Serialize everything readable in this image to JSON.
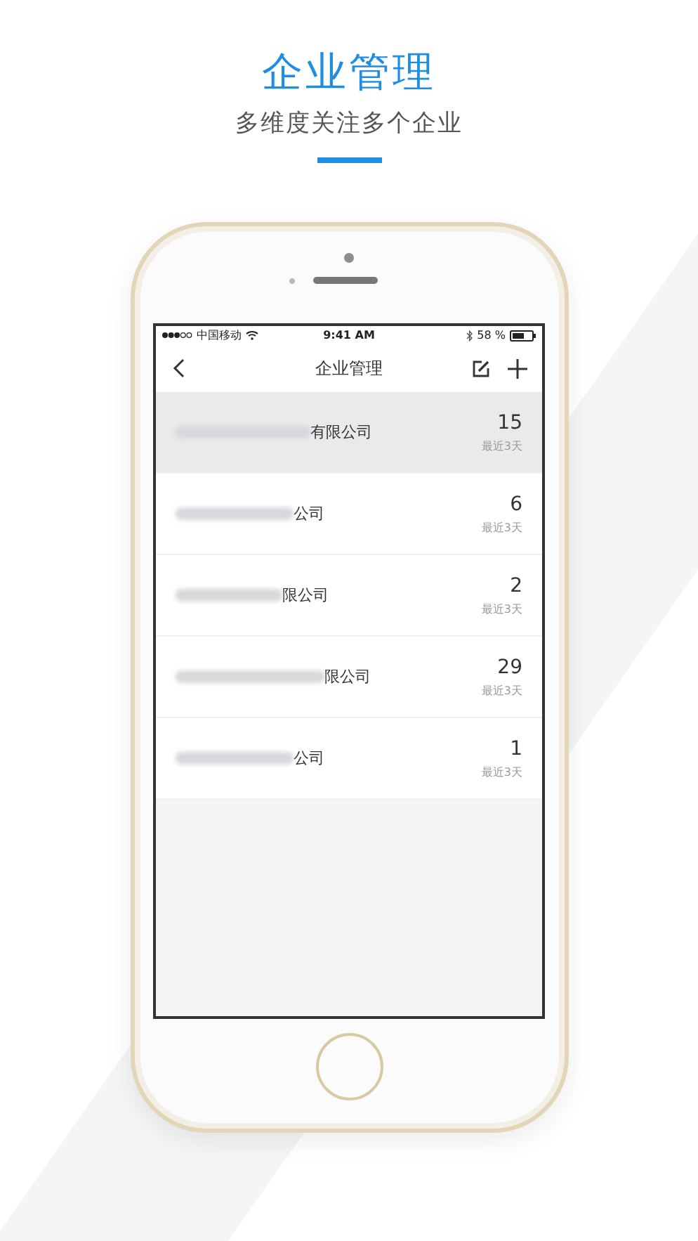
{
  "header": {
    "title": "企业管理",
    "subtitle": "多维度关注多个企业"
  },
  "status_bar": {
    "carrier": "中国移动",
    "time": "9:41 AM",
    "battery": "58 %"
  },
  "nav_bar": {
    "title": "企业管理"
  },
  "companies": [
    {
      "name_visible": "有限公司",
      "count": "15",
      "period": "最近3天",
      "selected": true
    },
    {
      "name_visible": "公司",
      "count": "6",
      "period": "最近3天",
      "selected": false
    },
    {
      "name_visible": "限公司",
      "count": "2",
      "period": "最近3天",
      "selected": false
    },
    {
      "name_visible": "限公司",
      "count": "29",
      "period": "最近3天",
      "selected": false
    },
    {
      "name_visible": "公司",
      "count": "1",
      "period": "最近3天",
      "selected": false
    }
  ]
}
